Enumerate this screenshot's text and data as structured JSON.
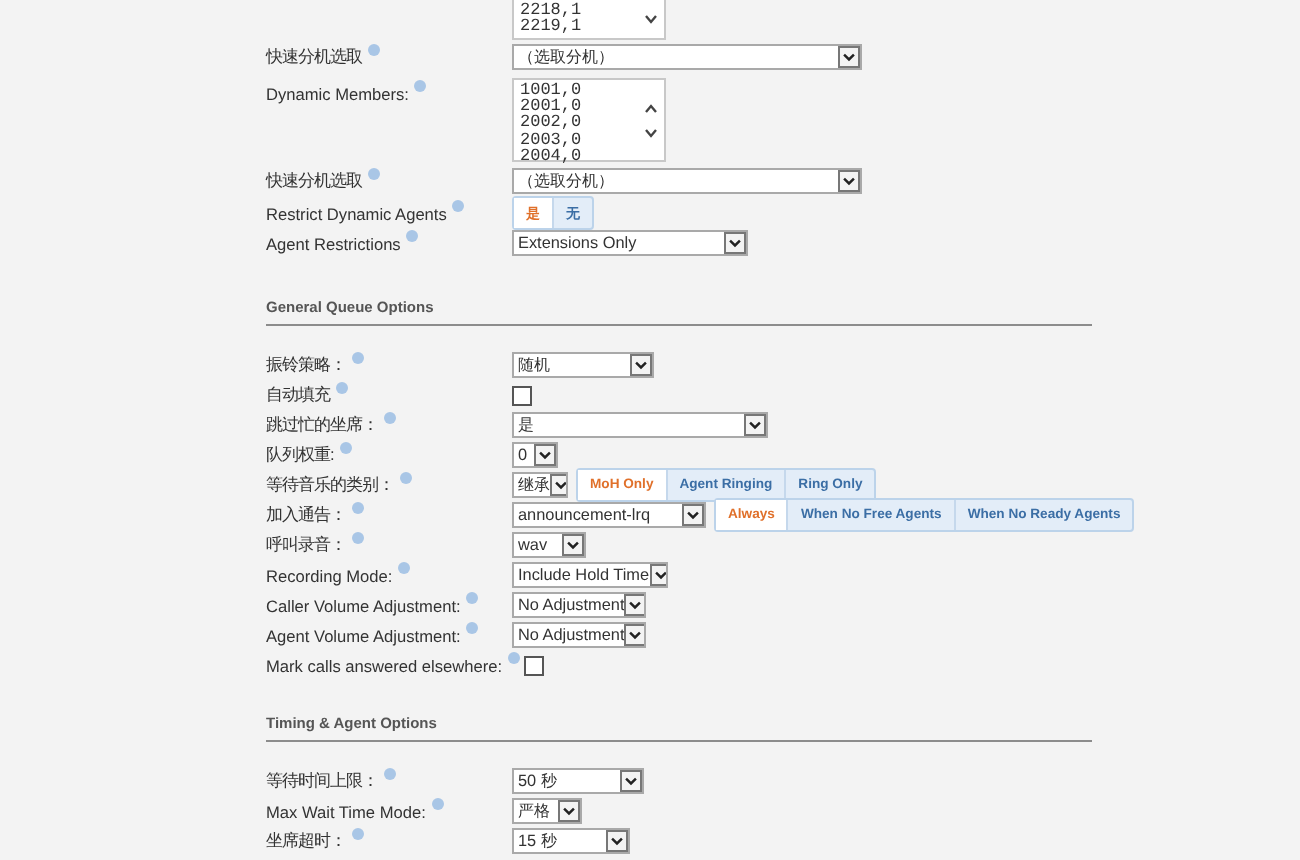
{
  "rows": [
    {
      "kind": "listbox",
      "items": [
        "2218,1",
        "2219,1"
      ]
    },
    {
      "kind": "select",
      "label": "快速分机选取",
      "value": "（选取分机）"
    },
    {
      "kind": "listbox",
      "label": "Dynamic Members:",
      "items": [
        "1001,0",
        "2001,0",
        "2002,0",
        "2003,0",
        "2004,0"
      ]
    },
    {
      "kind": "select",
      "label": "快速分机选取",
      "value": "（选取分机）"
    },
    {
      "kind": "toggle",
      "label": "Restrict Dynamic Agents",
      "options": [
        {
          "label": "是",
          "selected": true
        },
        {
          "label": "无",
          "selected": false
        }
      ]
    },
    {
      "kind": "select",
      "label": "Agent Restrictions",
      "value": "Extensions Only"
    },
    {
      "kind": "section",
      "title": "General Queue Options"
    },
    {
      "kind": "select",
      "label": "振铃策略：",
      "value": "随机"
    },
    {
      "kind": "checkbox",
      "label": "自动填充",
      "checked": false
    },
    {
      "kind": "select",
      "label": "跳过忙的坐席：",
      "value": "是"
    },
    {
      "kind": "select",
      "label": "队列权重:",
      "value": "0"
    },
    {
      "kind": "select",
      "label": "等待音乐的类别：",
      "value": "继承",
      "options": [
        {
          "label": "MoH Only",
          "selected": true
        },
        {
          "label": "Agent Ringing",
          "selected": false
        },
        {
          "label": "Ring Only",
          "selected": false
        }
      ]
    },
    {
      "kind": "select",
      "label": "加入通告：",
      "value": "announcement-lrq",
      "options": [
        {
          "label": "Always",
          "selected": true
        },
        {
          "label": "When No Free Agents",
          "selected": false
        },
        {
          "label": "When No Ready Agents",
          "selected": false
        }
      ]
    },
    {
      "kind": "select",
      "label": "呼叫录音：",
      "value": "wav"
    },
    {
      "kind": "select",
      "label": "Recording Mode:",
      "value": "Include Hold Time"
    },
    {
      "kind": "select",
      "label": "Caller Volume Adjustment:",
      "value": "No Adjustment"
    },
    {
      "kind": "select",
      "label": "Agent Volume Adjustment:",
      "value": "No Adjustment"
    },
    {
      "kind": "checkbox",
      "label": "Mark calls answered elsewhere:",
      "checked": false
    },
    {
      "kind": "section",
      "title": "Timing & Agent Options"
    },
    {
      "kind": "select",
      "label": "等待时间上限：",
      "value": "50 秒"
    },
    {
      "kind": "select",
      "label": "Max Wait Time Mode:",
      "value": "严格"
    },
    {
      "kind": "select",
      "label": "坐席超时：",
      "value": "15 秒"
    }
  ]
}
